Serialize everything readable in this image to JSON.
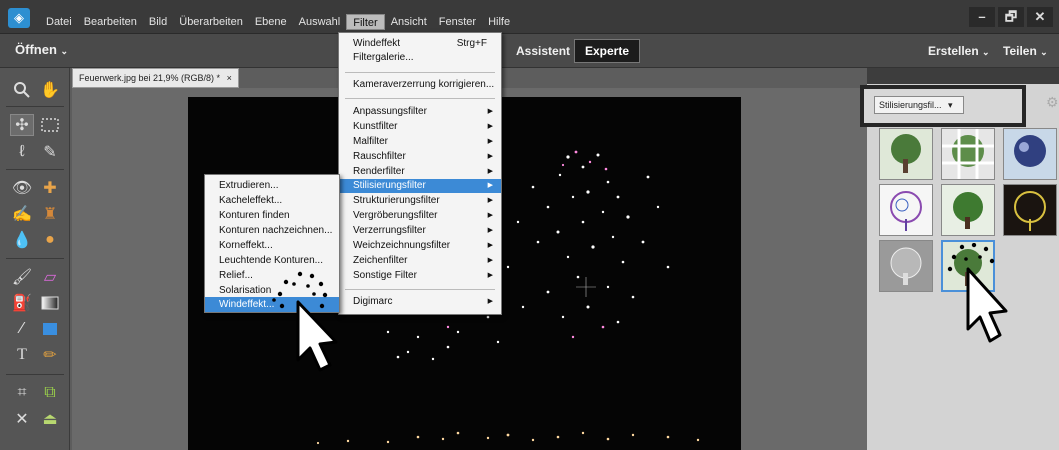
{
  "menubar": {
    "items": [
      "Datei",
      "Bearbeiten",
      "Bild",
      "Überarbeiten",
      "Ebene",
      "Auswahl",
      "Filter",
      "Ansicht",
      "Fenster",
      "Hilfe"
    ],
    "active_index": 6,
    "window_controls": [
      "–",
      "🗗",
      "✕"
    ]
  },
  "modebar": {
    "open_label": "Öffnen",
    "assist_label": "Assistent",
    "expert_label": "Experte",
    "create_label": "Erstellen",
    "share_label": "Teilen"
  },
  "document": {
    "tab_title": "Feuerwerk.jpg bei 21,9% (RGB/8) *",
    "tab_close": "×"
  },
  "filter_menu": {
    "items": [
      {
        "label": "Windeffekt",
        "shortcut": "Strg+F"
      },
      {
        "label": "Filtergalerie..."
      },
      {
        "label": "Kameraverzerrung korrigieren..."
      },
      {
        "label": "Anpassungsfilter",
        "submenu": true
      },
      {
        "label": "Kunstfilter",
        "submenu": true
      },
      {
        "label": "Malfilter",
        "submenu": true
      },
      {
        "label": "Rauschfilter",
        "submenu": true
      },
      {
        "label": "Renderfilter",
        "submenu": true
      },
      {
        "label": "Stilisierungsfilter",
        "submenu": true,
        "highlight": true
      },
      {
        "label": "Strukturierungsfilter",
        "submenu": true
      },
      {
        "label": "Vergröberungsfilter",
        "submenu": true
      },
      {
        "label": "Verzerrungsfilter",
        "submenu": true
      },
      {
        "label": "Weichzeichnungsfilter",
        "submenu": true
      },
      {
        "label": "Zeichenfilter",
        "submenu": true
      },
      {
        "label": "Sonstige Filter",
        "submenu": true
      },
      {
        "label": "Digimarc",
        "submenu": true
      }
    ]
  },
  "submenu": {
    "items": [
      "Extrudieren...",
      "Kacheleffekt...",
      "Konturen finden",
      "Konturen nachzeichnen...",
      "Korneffekt...",
      "Leuchtende Konturen...",
      "Relief...",
      "Solarisation",
      "Windeffekt..."
    ],
    "highlight_index": 8
  },
  "right_panel": {
    "dropdown_value": "Stilisierungsfil...",
    "dropdown_arrow": "▾"
  },
  "icons": {
    "app_logo": "app-logo-icon",
    "chevron": "chevron-down-icon"
  },
  "colors": {
    "highlight": "#3c8ad6",
    "menubar": "#3a3a3a"
  }
}
